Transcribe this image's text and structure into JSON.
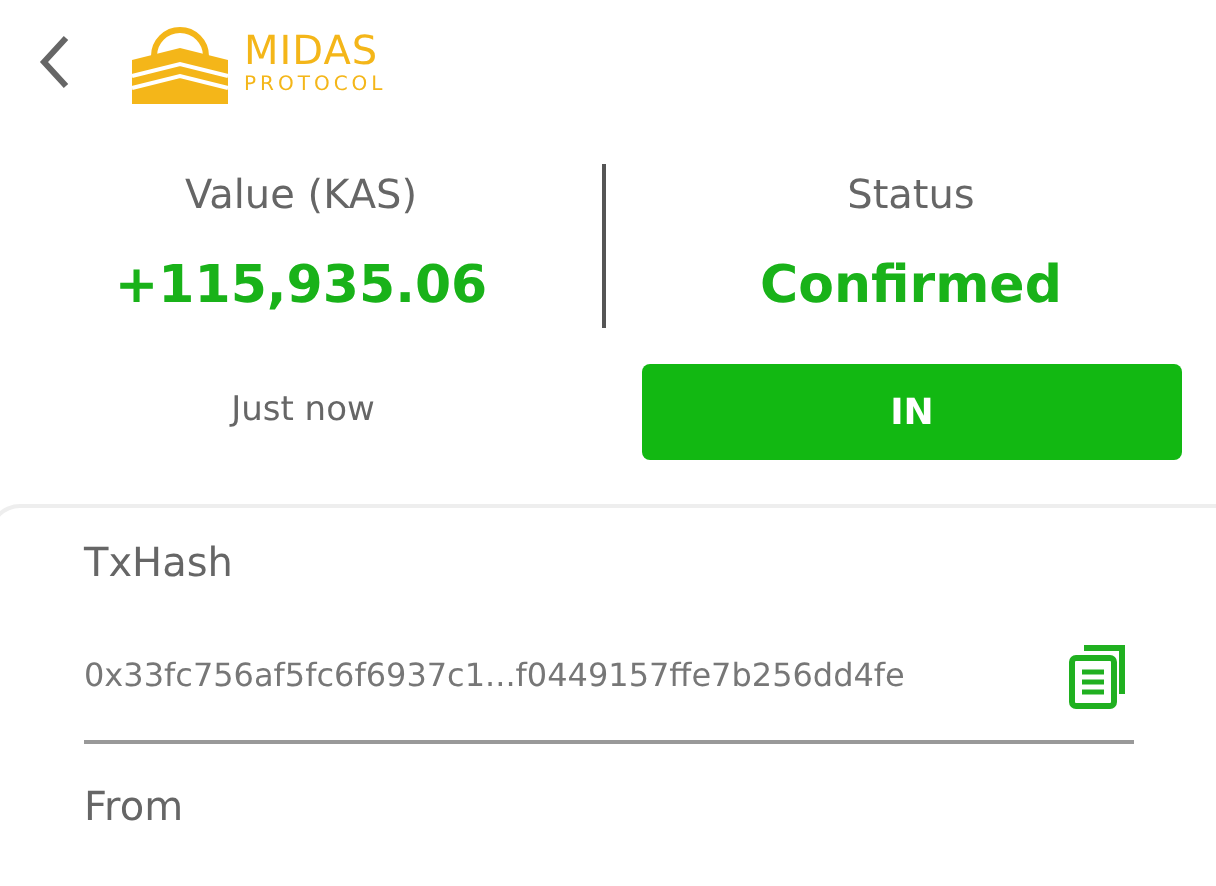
{
  "logo": {
    "name": "MIDAS",
    "subtitle": "PROTOCOL"
  },
  "summary": {
    "value_label": "Value (KAS)",
    "value": "+115,935.06",
    "time": "Just now",
    "status_label": "Status",
    "status": "Confirmed",
    "direction": "IN"
  },
  "details": [
    {
      "label": "TxHash",
      "value": "0x33fc756af5fc6f6937c1...f0449157ffe7b256dd4fe"
    },
    {
      "label": "From"
    }
  ]
}
